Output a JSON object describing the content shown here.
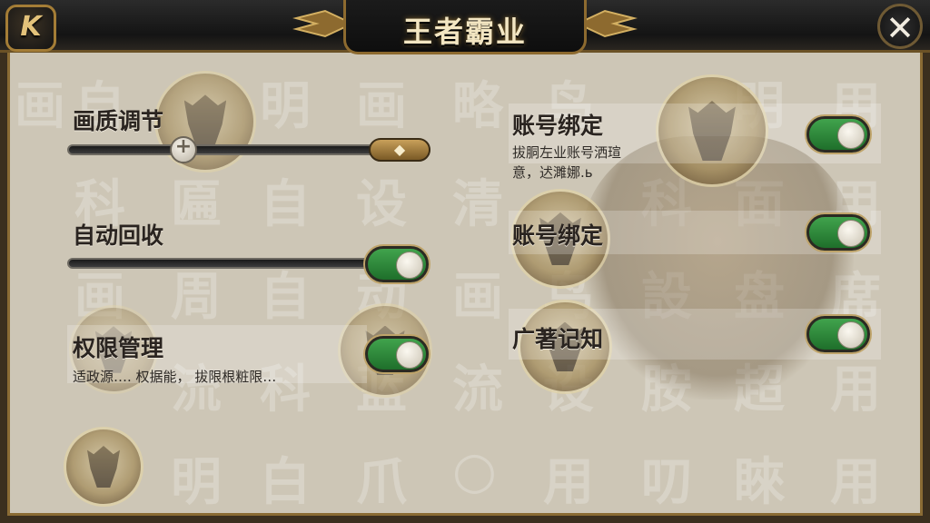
{
  "header": {
    "title": "王者霸业",
    "logo_glyph": "K",
    "close_glyph": "✕"
  },
  "background_glyphs": [
    "画",
    "自",
    "明",
    "画",
    "略",
    "鸟",
    "明",
    "用",
    "科",
    "匾",
    "自",
    "设",
    "清",
    "科",
    "面",
    "用",
    "画",
    "周",
    "自",
    "动",
    "画",
    "鸟",
    "設",
    "盘",
    "席",
    "流",
    "科",
    "蓝",
    "流",
    "设",
    "胺",
    "超",
    "用",
    "明",
    "白",
    "爪",
    "○",
    "用",
    "叨",
    "睞",
    "用"
  ],
  "left_panel": {
    "quality": {
      "label": "画质调节",
      "end_glyph": "◆",
      "knob_glyph": "+",
      "level": 0.32
    },
    "auto_recycle": {
      "label": "自动回收",
      "enabled": true
    },
    "permissions": {
      "label": "权限管理",
      "desc": "适政源…. 权据能， 拔限根粧限…",
      "enabled": true
    }
  },
  "right_panel": {
    "account_binding_1": {
      "label": "账号绑定",
      "desc_line1": "拔胴左业账号洒瑄",
      "desc_line2": "意，迖濉娜.ь",
      "enabled": true
    },
    "account_binding_2": {
      "label": "账号绑定",
      "enabled": true
    },
    "ad_notice": {
      "label": "广著记知",
      "enabled": true
    }
  },
  "colors": {
    "toggle_on": "#34963f",
    "gold_frame": "#8d6a2f",
    "panel_bg": "#cdc6b6"
  }
}
